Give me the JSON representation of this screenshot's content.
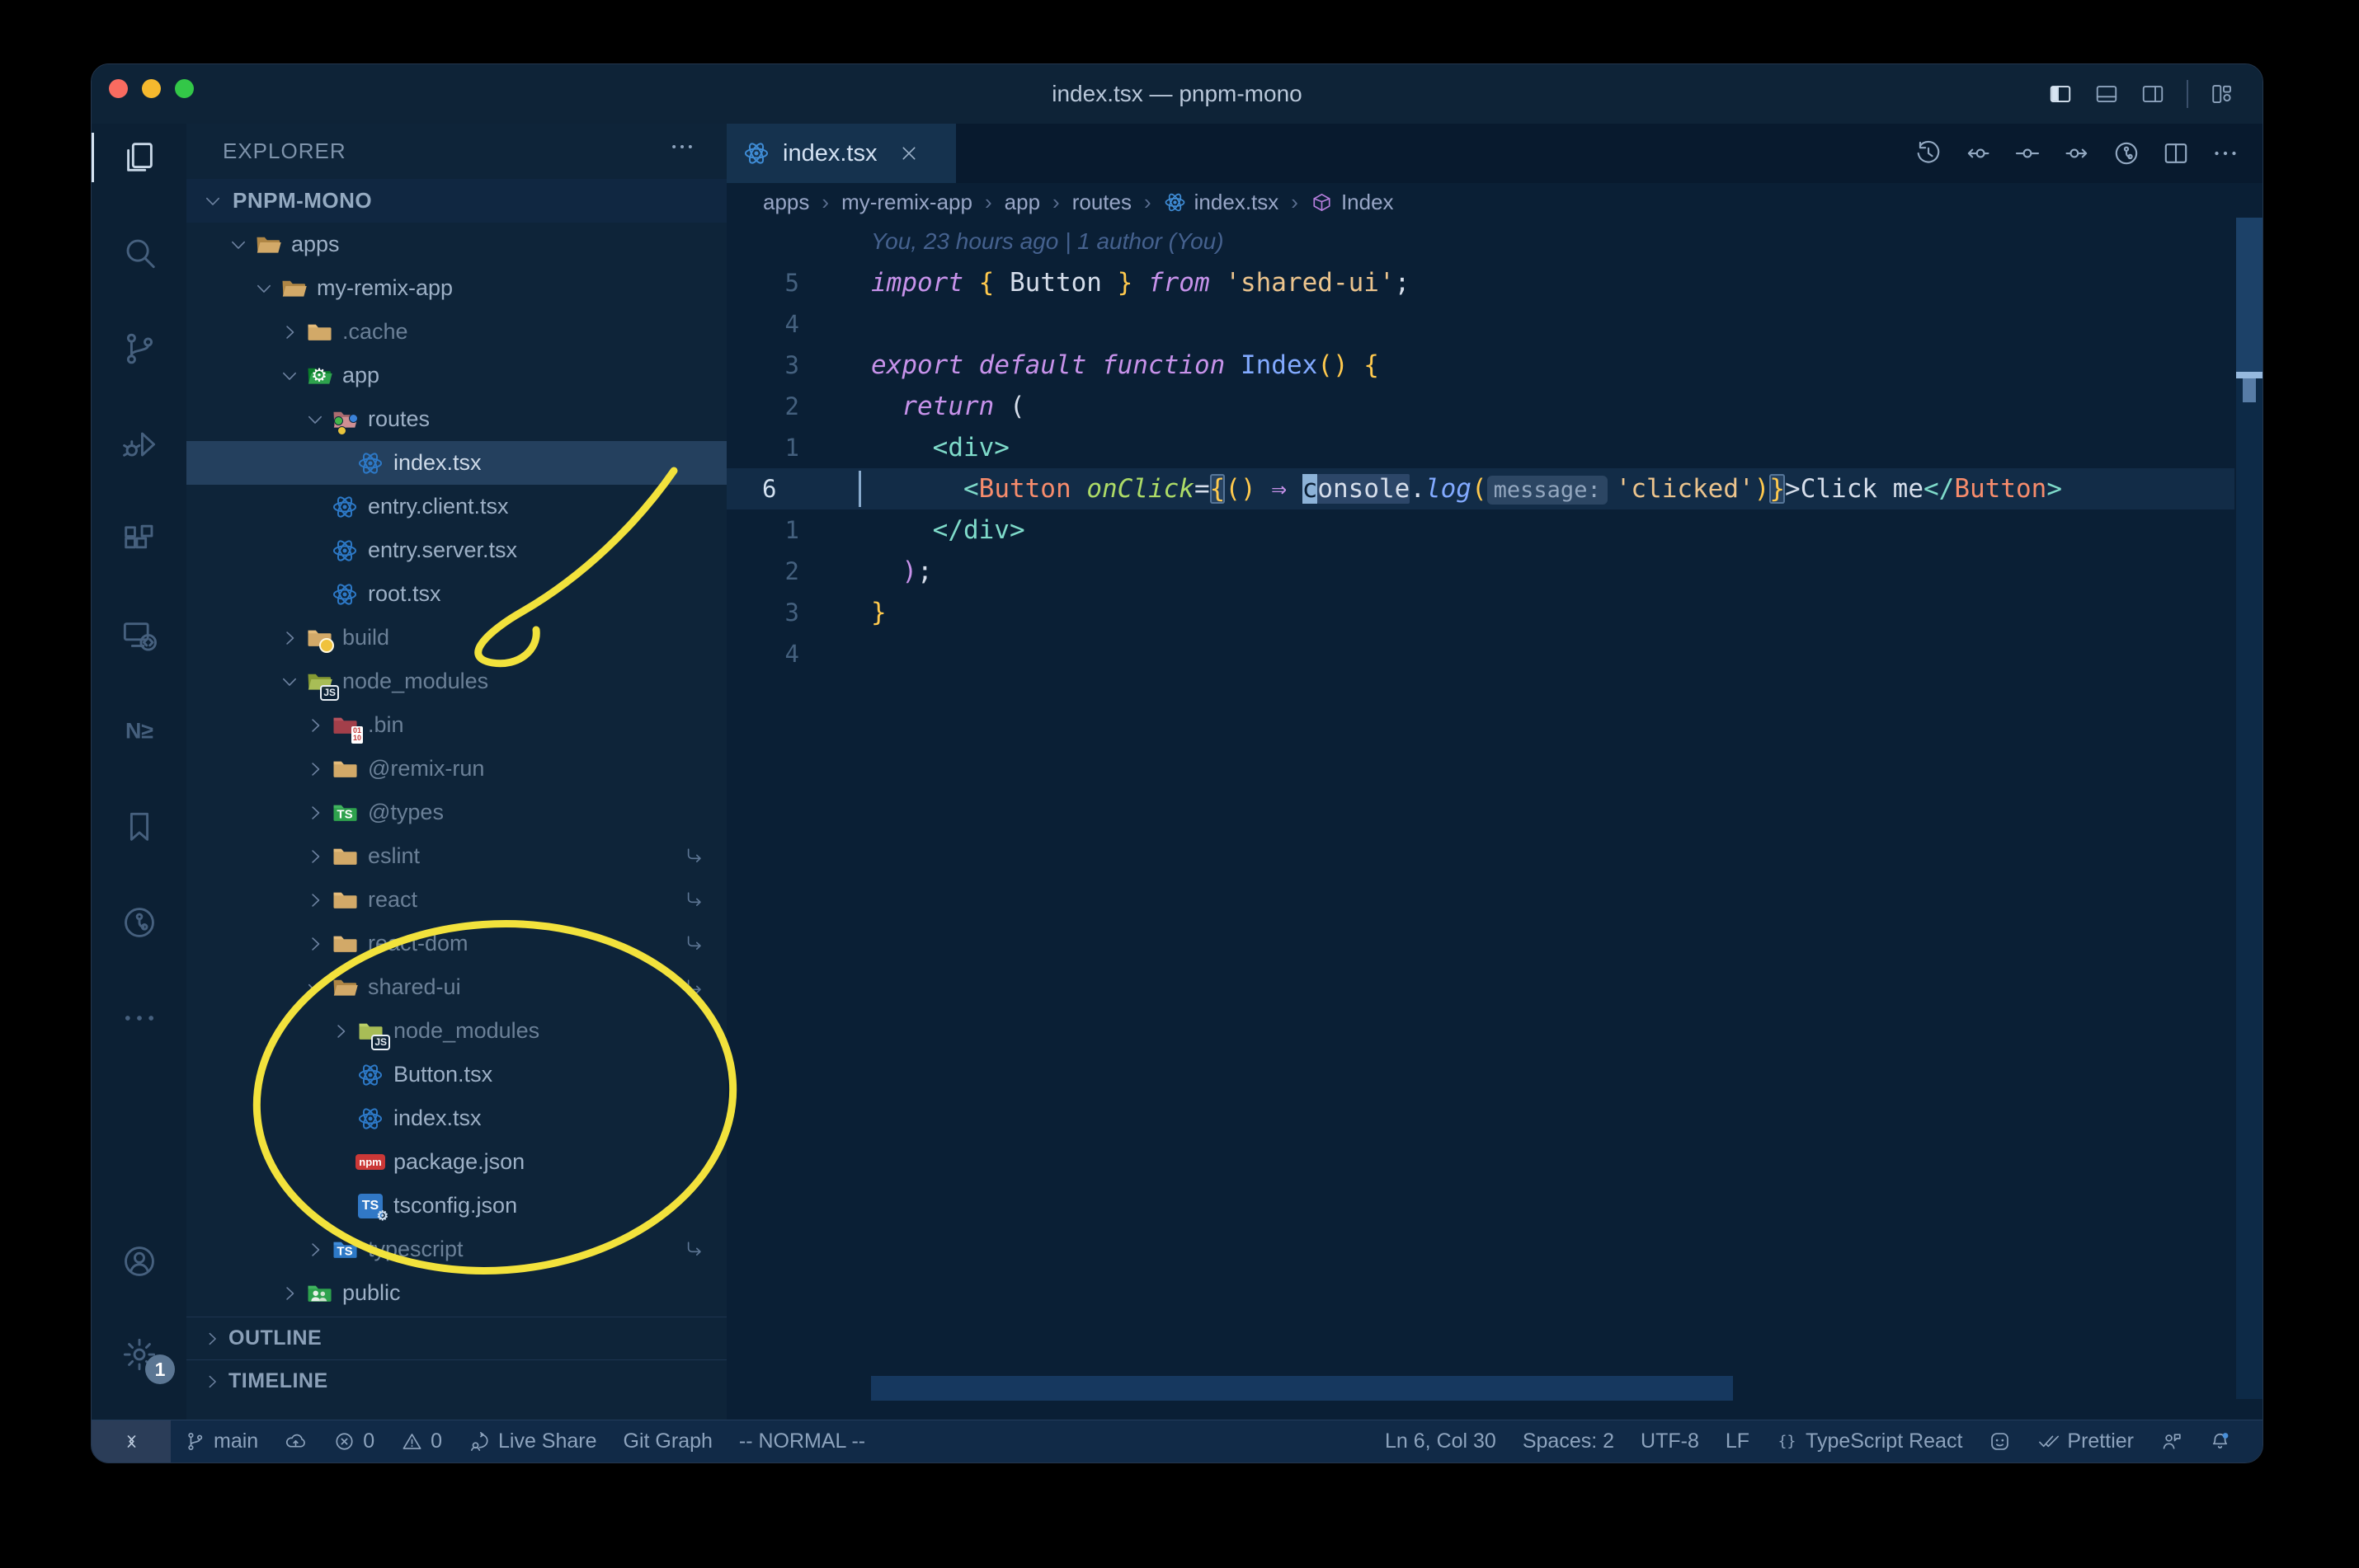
{
  "window": {
    "title": "index.tsx — pnpm-mono",
    "traffic_lights": [
      {
        "name": "close-button",
        "color": "#f96b60"
      },
      {
        "name": "minimize-button",
        "color": "#f5b92e"
      },
      {
        "name": "zoom-button",
        "color": "#33c748"
      }
    ],
    "titlebar_icons": [
      {
        "name": "toggle-primary-sidebar-icon",
        "icon": "layout-left",
        "active": true
      },
      {
        "name": "toggle-panel-icon",
        "icon": "layout-panel"
      },
      {
        "name": "toggle-secondary-sidebar-icon",
        "icon": "layout-right"
      },
      {
        "name": "customize-layout-icon",
        "icon": "layout-custom",
        "separated": true
      }
    ]
  },
  "activity_bar": {
    "top": [
      {
        "name": "explorer",
        "icon": "files",
        "active": true
      },
      {
        "name": "search",
        "icon": "search"
      },
      {
        "name": "source-control",
        "icon": "scm"
      },
      {
        "name": "run-and-debug",
        "icon": "debug"
      },
      {
        "name": "extensions",
        "icon": "ext"
      },
      {
        "name": "remote-explorer",
        "icon": "remote"
      },
      {
        "name": "nx-console",
        "icon": "nx"
      },
      {
        "name": "bookmarks",
        "icon": "bookmark"
      },
      {
        "name": "gitlens",
        "icon": "gitlens"
      },
      {
        "name": "more-views",
        "icon": "ellipsis"
      }
    ],
    "bottom": [
      {
        "name": "accounts",
        "icon": "account"
      },
      {
        "name": "settings",
        "icon": "gear",
        "badge": "1"
      }
    ]
  },
  "sidebar": {
    "title": "EXPLORER",
    "tree": [
      {
        "label": "PNPM-MONO",
        "level": 0,
        "kind": "root",
        "state": "open"
      },
      {
        "label": "apps",
        "level": 1,
        "kind": "folder",
        "state": "open",
        "color": "tan"
      },
      {
        "label": "my-remix-app",
        "level": 2,
        "kind": "folder",
        "state": "open",
        "color": "tan"
      },
      {
        "label": ".cache",
        "level": 3,
        "kind": "folder",
        "state": "closed",
        "color": "tan",
        "dim": true
      },
      {
        "label": "app",
        "level": 3,
        "kind": "folder",
        "state": "open",
        "color": "green",
        "badge": "gear"
      },
      {
        "label": "routes",
        "level": 4,
        "kind": "folder",
        "state": "open",
        "color": "pink",
        "badge": "dots"
      },
      {
        "label": "index.tsx",
        "level": 5,
        "kind": "file",
        "icon": "react",
        "selected": true
      },
      {
        "label": "entry.client.tsx",
        "level": 4,
        "kind": "file",
        "icon": "react"
      },
      {
        "label": "entry.server.tsx",
        "level": 4,
        "kind": "file",
        "icon": "react"
      },
      {
        "label": "root.tsx",
        "level": 4,
        "kind": "file",
        "icon": "react"
      },
      {
        "label": "build",
        "level": 3,
        "kind": "folder",
        "state": "closed",
        "color": "tan",
        "badge": "dot",
        "dim": true
      },
      {
        "label": "node_modules",
        "level": 3,
        "kind": "folder",
        "state": "open",
        "color": "olive",
        "badge": "js",
        "dim": true
      },
      {
        "label": ".bin",
        "level": 4,
        "kind": "folder",
        "state": "closed",
        "color": "maroon",
        "badge": "bin",
        "dim": true
      },
      {
        "label": "@remix-run",
        "level": 4,
        "kind": "folder",
        "state": "closed",
        "color": "tan",
        "dim": true
      },
      {
        "label": "@types",
        "level": 4,
        "kind": "folder",
        "state": "closed",
        "color": "green",
        "badge": "ts",
        "dim": true
      },
      {
        "label": "eslint",
        "level": 4,
        "kind": "folder",
        "state": "closed",
        "color": "tan",
        "dim": true,
        "symlink": true
      },
      {
        "label": "react",
        "level": 4,
        "kind": "folder",
        "state": "closed",
        "color": "tan",
        "dim": true,
        "symlink": true
      },
      {
        "label": "react-dom",
        "level": 4,
        "kind": "folder",
        "state": "closed",
        "color": "tan",
        "dim": true,
        "symlink": true
      },
      {
        "label": "shared-ui",
        "level": 4,
        "kind": "folder",
        "state": "open",
        "color": "tan",
        "dim": true,
        "symlink": true
      },
      {
        "label": "node_modules",
        "level": 5,
        "kind": "folder",
        "state": "closed",
        "color": "olive",
        "badge": "js",
        "dim": true
      },
      {
        "label": "Button.tsx",
        "level": 5,
        "kind": "file",
        "icon": "react"
      },
      {
        "label": "index.tsx",
        "level": 5,
        "kind": "file",
        "icon": "react"
      },
      {
        "label": "package.json",
        "level": 5,
        "kind": "file",
        "icon": "npm"
      },
      {
        "label": "tsconfig.json",
        "level": 5,
        "kind": "file",
        "icon": "tsconfig"
      },
      {
        "label": "typescript",
        "level": 4,
        "kind": "folder",
        "state": "closed",
        "color": "blue",
        "badge": "ts",
        "dim": true,
        "symlink": true
      },
      {
        "label": "public",
        "level": 3,
        "kind": "folder",
        "state": "closed",
        "color": "green",
        "badge": "people"
      }
    ],
    "sections": [
      {
        "label": "OUTLINE"
      },
      {
        "label": "TIMELINE"
      }
    ]
  },
  "editor": {
    "tab": {
      "label": "index.tsx",
      "icon": "react"
    },
    "actions": [
      {
        "name": "timeline-history-icon",
        "icon": "history"
      },
      {
        "name": "previous-change-icon",
        "icon": "prev-change"
      },
      {
        "name": "commit-icon",
        "icon": "commit"
      },
      {
        "name": "next-change-icon",
        "icon": "next-change"
      },
      {
        "name": "gitlens-graph-icon",
        "icon": "gitlens"
      },
      {
        "name": "split-editor-icon",
        "icon": "split"
      },
      {
        "name": "more-actions-icon",
        "icon": "ellipsis"
      }
    ],
    "breadcrumbs": [
      {
        "label": "apps"
      },
      {
        "label": "my-remix-app"
      },
      {
        "label": "app"
      },
      {
        "label": "routes"
      },
      {
        "label": "index.tsx",
        "icon": "react"
      },
      {
        "label": "Index",
        "icon": "symbol-structure"
      }
    ],
    "code_lines": [
      {
        "blame": "You, 23 hours ago | 1 author (You)"
      },
      {
        "n": "5",
        "t": [
          [
            "import",
            "k"
          ],
          [
            " ",
            "t"
          ],
          [
            "{",
            "y"
          ],
          [
            " Button ",
            "t"
          ],
          [
            "}",
            "y"
          ],
          [
            " ",
            "t"
          ],
          [
            "from",
            "k"
          ],
          [
            " ",
            "t"
          ],
          [
            "'shared-ui'",
            "s"
          ],
          [
            ";",
            "t"
          ]
        ]
      },
      {
        "n": "4",
        "t": []
      },
      {
        "n": "3",
        "t": [
          [
            "export",
            "k"
          ],
          [
            " ",
            "t"
          ],
          [
            "default",
            "k"
          ],
          [
            " ",
            "t"
          ],
          [
            "function",
            "k"
          ],
          [
            " ",
            "t"
          ],
          [
            "Index",
            "nb"
          ],
          [
            "()",
            "y"
          ],
          [
            " ",
            "t"
          ],
          [
            "{",
            "y"
          ]
        ]
      },
      {
        "n": "2",
        "t": [
          [
            "  ",
            "t"
          ],
          [
            "return",
            "k"
          ],
          [
            " (",
            "t"
          ]
        ]
      },
      {
        "n": "1",
        "t": [
          [
            "    ",
            "t"
          ],
          [
            "<div>",
            "tl"
          ]
        ]
      },
      {
        "n": "6",
        "cur": true,
        "t": [
          [
            "      ",
            "t"
          ],
          [
            "<",
            "tl"
          ],
          [
            "Button",
            "tg"
          ],
          [
            " ",
            "t"
          ],
          [
            "onClick",
            "at"
          ],
          [
            "=",
            "t"
          ],
          [
            "{",
            "y bm"
          ],
          [
            "()",
            "y"
          ],
          [
            " ",
            "t"
          ],
          [
            "⇒",
            "ar"
          ],
          [
            " ",
            "t"
          ],
          [
            "c",
            "cb"
          ],
          [
            "onsole",
            "t whl"
          ],
          [
            ".",
            "t"
          ],
          [
            "log",
            "fb"
          ],
          [
            "(",
            "y"
          ],
          [
            "message:",
            "inl"
          ],
          [
            "'clicked'",
            "s"
          ],
          [
            ")",
            "y"
          ],
          [
            "}",
            "y bm"
          ],
          [
            ">",
            "t"
          ],
          [
            "Click me",
            "t"
          ],
          [
            "</",
            "tl"
          ],
          [
            "Button",
            "tg"
          ],
          [
            ">",
            "tl"
          ]
        ]
      },
      {
        "n": "1",
        "t": [
          [
            "    ",
            "t"
          ],
          [
            "</div>",
            "tl"
          ]
        ]
      },
      {
        "n": "2",
        "t": [
          [
            "  ",
            "t"
          ],
          [
            ")",
            "pp"
          ],
          [
            ";",
            "t"
          ]
        ]
      },
      {
        "n": "3",
        "t": [
          [
            "}",
            "y"
          ]
        ]
      },
      {
        "n": "4",
        "t": []
      }
    ]
  },
  "status_bar": {
    "left": [
      {
        "name": "remote-indicator",
        "icon": "remote-ind",
        "box": true
      },
      {
        "name": "git-branch",
        "icon": "branch",
        "text": "main"
      },
      {
        "name": "publish-changes",
        "icon": "cloud"
      },
      {
        "name": "errors",
        "icon": "error",
        "text": "0"
      },
      {
        "name": "warnings",
        "icon": "warning",
        "text": "0"
      },
      {
        "name": "live-share",
        "icon": "liveshare",
        "text": "Live Share"
      },
      {
        "name": "git-graph",
        "text": "Git Graph"
      },
      {
        "name": "vim-mode",
        "text": "-- NORMAL --"
      }
    ],
    "right": [
      {
        "name": "cursor-position",
        "text": "Ln 6, Col 30"
      },
      {
        "name": "indentation",
        "text": "Spaces: 2"
      },
      {
        "name": "encoding",
        "text": "UTF-8"
      },
      {
        "name": "eol-sequence",
        "text": "LF"
      },
      {
        "name": "language-mode",
        "icon": "brackets",
        "text": "TypeScript React"
      },
      {
        "name": "github",
        "icon": "github"
      },
      {
        "name": "formatter-prettier",
        "icon": "prettier",
        "text": "Prettier"
      },
      {
        "name": "feedback",
        "icon": "feedback"
      },
      {
        "name": "notifications",
        "icon": "bell"
      }
    ]
  },
  "annotations": {
    "color": "#f2e23c",
    "arrow": {
      "name": "hand-drawn-arrow",
      "points_at": "node_modules folder"
    },
    "ellipse": {
      "name": "hand-drawn-circle",
      "around": "shared-ui package contents"
    }
  },
  "colors": {
    "folder_tan": "#d2a968",
    "folder_green": "#2ea24d",
    "folder_blue": "#2d79c7",
    "folder_olive": "#a8bd56",
    "folder_pink": "#cf8f93",
    "folder_maroon": "#a33f4a",
    "react_blue": "#2d79c7",
    "npm_red": "#cb3837",
    "ts_blue": "#3178c6",
    "selected_row": "#24405e",
    "current_line": "#122c47"
  }
}
